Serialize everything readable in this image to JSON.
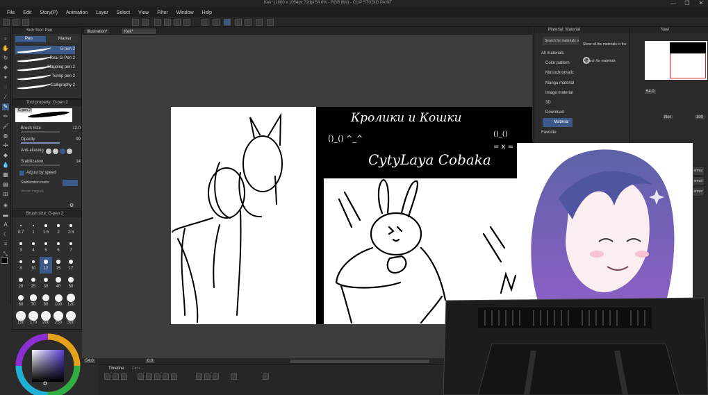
{
  "window": {
    "title": "Kek* (1800 x 1054px 72dpi 54.0%  - RGB 8bit) - CLIP STUDIO PAINT",
    "controls": [
      "—",
      "❐",
      "✕"
    ]
  },
  "menu": [
    "File",
    "Edit",
    "Story(P)",
    "Animation",
    "Layer",
    "Select",
    "View",
    "Filter",
    "Window",
    "Help"
  ],
  "sub_tool": {
    "header": "Sub Tool: Pen",
    "tabs": [
      "Pen",
      "Marker"
    ],
    "brushes": [
      "G-pen 2",
      "Real G-Pen 2",
      "Mapping pen 2",
      "Turnip pen 2",
      "Calligraphy 2"
    ],
    "selected": "G-pen 2"
  },
  "tool_property": {
    "header": "Tool property: G-pen 2",
    "preview_name": "G-pen 2",
    "brush_size_label": "Brush Size",
    "brush_size_value": "12.0",
    "opacity_label": "Opacity",
    "opacity_value": "99",
    "anti_aliasing_label": "Anti-aliasing",
    "stabilization_label": "Stabilization",
    "stabilization_value": "14",
    "adjust_by_speed_label": "Adjust by speed",
    "stabilization_mode_label": "Stabilization mode",
    "vector_magnet_label": "Vector magnet"
  },
  "brush_size_panel": {
    "header": "Brush size: G-pen 2",
    "sizes": [
      "0.7",
      "1",
      "1.5",
      "2",
      "2.5",
      "3",
      "4",
      "5",
      "6",
      "7",
      "8",
      "10",
      "12",
      "15",
      "17",
      "20",
      "25",
      "30",
      "40",
      "50",
      "60",
      "70",
      "80",
      "100",
      "120",
      "150",
      "170",
      "200",
      "250",
      "300"
    ],
    "selected": "12"
  },
  "canvas": {
    "tabs": [
      "Illustration*",
      "Kek*"
    ],
    "active_tab": "Kek*",
    "zoom": "54.0",
    "frame": "0.0",
    "heading_text": "Кролики и Кошки",
    "emoticon_left": "()_() ^_^",
    "emoticon_right_top": "()_()",
    "emoticon_right_bottom": "= x =",
    "caption": "CytyLaya Cobaka"
  },
  "timeline": {
    "label": "Timeline",
    "sublabel": "Ctrl + ..."
  },
  "material_panel": {
    "header": "Material: Material",
    "search_placeholder": "Search for materials on A",
    "show_all": "Show all the materials in the",
    "search_btn": "Search for materials",
    "tree": [
      "All materials",
      "Color pattern",
      "Monochromatic",
      "Manga material",
      "Image material",
      "3D",
      "Download",
      "Material",
      "Favorite"
    ],
    "selected": "Material"
  },
  "navigator": {
    "header": "Navi",
    "zoom": "54.0",
    "opacity": "100",
    "layer_mode": "Nor",
    "layer_rows": [
      "ormal",
      "ormal",
      "ormal"
    ]
  },
  "colors": {
    "accent": "#3b5a8a",
    "panel": "#2e2e2e",
    "canvas_bg": "#3c3c3c"
  }
}
